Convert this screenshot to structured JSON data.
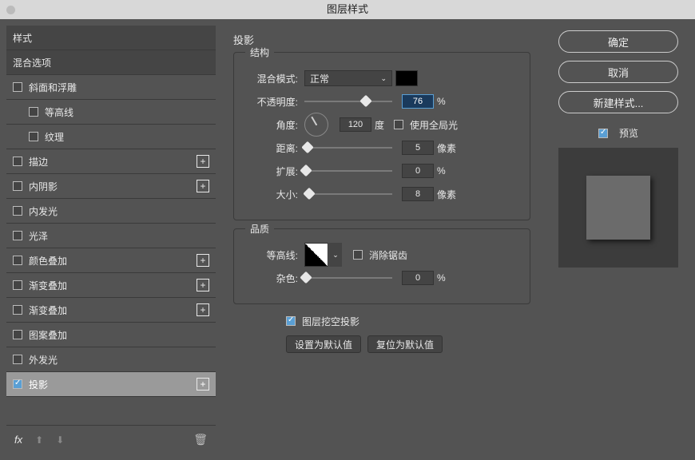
{
  "title": "图层样式",
  "sidebar": {
    "header": "样式",
    "blending": "混合选项",
    "items": [
      {
        "label": "斜面和浮雕",
        "checked": false,
        "addable": false,
        "sub": false
      },
      {
        "label": "等高线",
        "checked": false,
        "addable": false,
        "sub": true
      },
      {
        "label": "纹理",
        "checked": false,
        "addable": false,
        "sub": true
      },
      {
        "label": "描边",
        "checked": false,
        "addable": true,
        "sub": false
      },
      {
        "label": "内阴影",
        "checked": false,
        "addable": true,
        "sub": false
      },
      {
        "label": "内发光",
        "checked": false,
        "addable": false,
        "sub": false
      },
      {
        "label": "光泽",
        "checked": false,
        "addable": false,
        "sub": false
      },
      {
        "label": "颜色叠加",
        "checked": false,
        "addable": true,
        "sub": false
      },
      {
        "label": "渐变叠加",
        "checked": false,
        "addable": true,
        "sub": false
      },
      {
        "label": "渐变叠加",
        "checked": false,
        "addable": true,
        "sub": false
      },
      {
        "label": "图案叠加",
        "checked": false,
        "addable": false,
        "sub": false
      },
      {
        "label": "外发光",
        "checked": false,
        "addable": false,
        "sub": false
      },
      {
        "label": "投影",
        "checked": true,
        "addable": true,
        "sub": false,
        "active": true
      }
    ],
    "fx": "fx"
  },
  "panel": {
    "title": "投影",
    "structure": "结构",
    "blend_mode": {
      "label": "混合模式:",
      "value": "正常"
    },
    "opacity": {
      "label": "不透明度:",
      "value": "76",
      "unit": "%",
      "pos": 70
    },
    "angle": {
      "label": "角度:",
      "value": "120",
      "unit": "度"
    },
    "global_light": {
      "label": "使用全局光",
      "checked": false
    },
    "distance": {
      "label": "距离:",
      "value": "5",
      "unit": "像素",
      "pos": 4
    },
    "spread": {
      "label": "扩展:",
      "value": "0",
      "unit": "%",
      "pos": 2
    },
    "size": {
      "label": "大小:",
      "value": "8",
      "unit": "像素",
      "pos": 5
    },
    "quality": "品质",
    "contour": {
      "label": "等高线:"
    },
    "antialias": {
      "label": "消除锯齿",
      "checked": false
    },
    "noise": {
      "label": "杂色:",
      "value": "0",
      "unit": "%",
      "pos": 2
    },
    "knockout": {
      "label": "图层挖空投影",
      "checked": true
    },
    "set_default": "设置为默认值",
    "reset_default": "复位为默认值"
  },
  "right": {
    "ok": "确定",
    "cancel": "取消",
    "new_style": "新建样式...",
    "preview": {
      "label": "预览",
      "checked": true
    }
  }
}
